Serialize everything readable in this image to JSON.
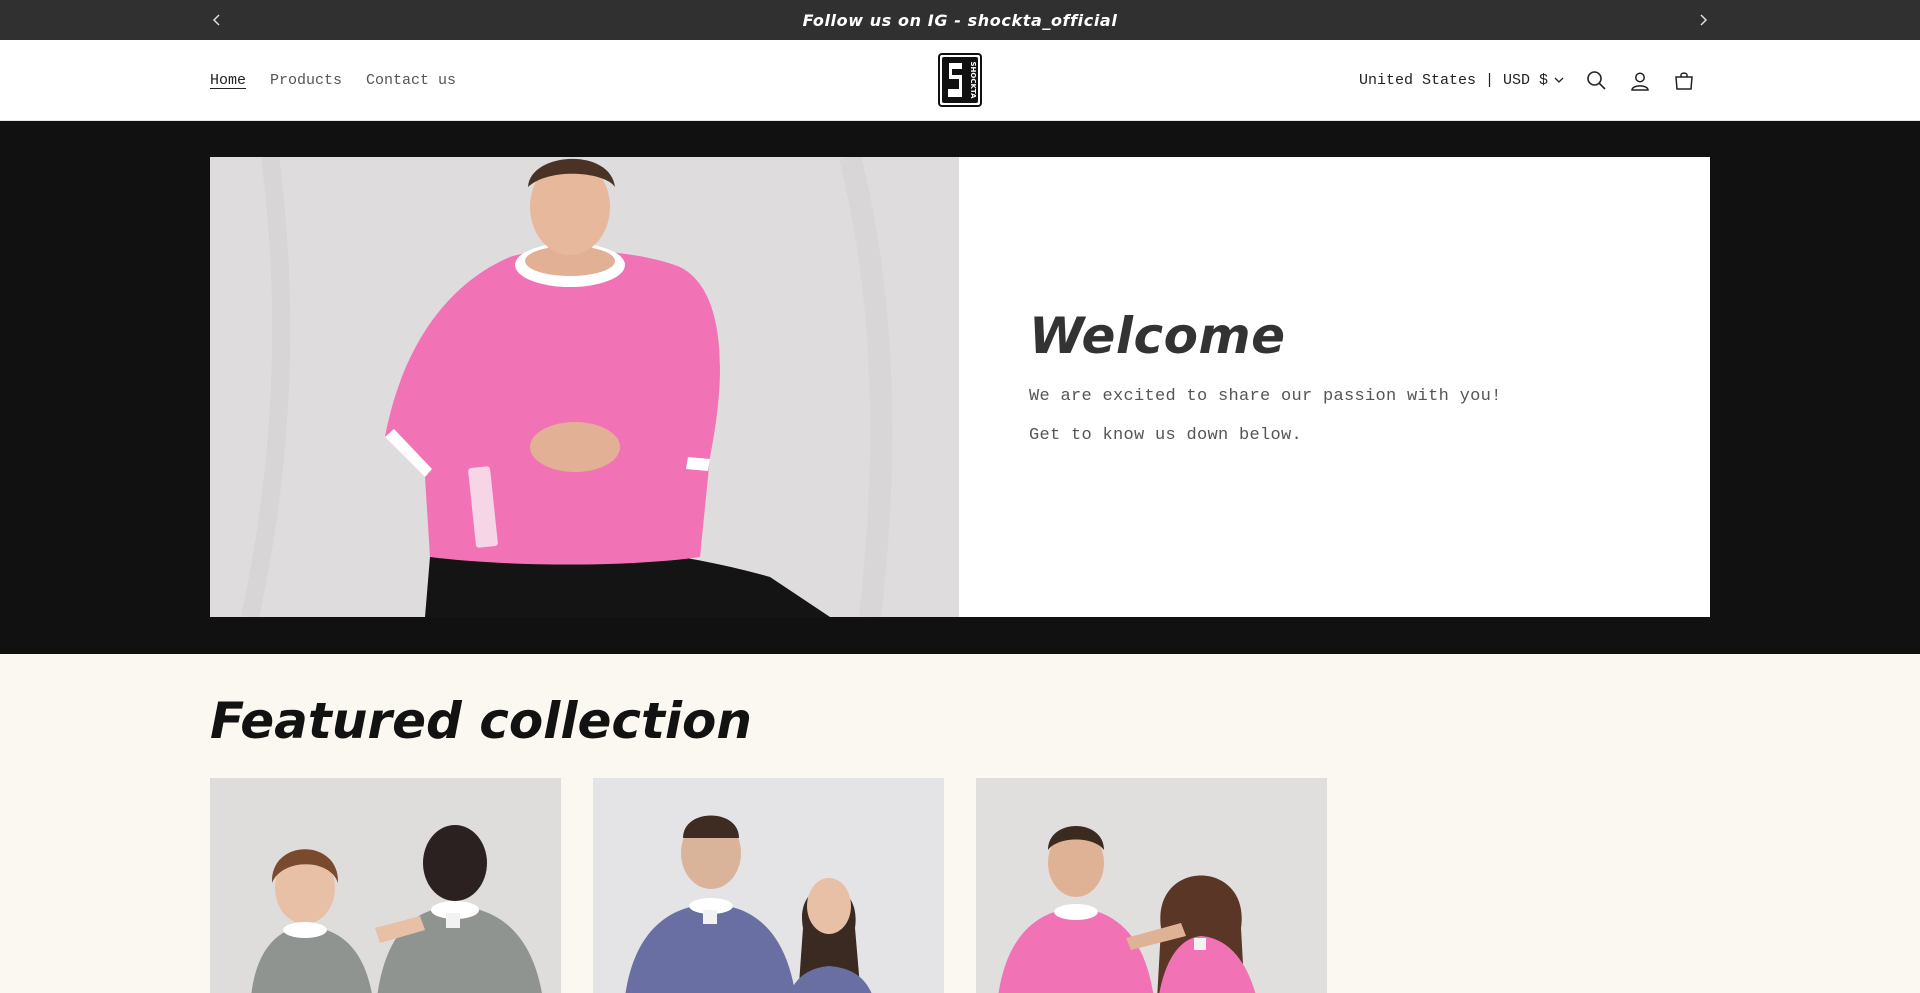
{
  "announcement": {
    "message": "Follow us on IG - shockta_official",
    "prev_icon": "chevron-left-icon",
    "next_icon": "chevron-right-icon"
  },
  "header": {
    "nav": [
      {
        "label": "Home",
        "active": true
      },
      {
        "label": "Products",
        "active": false
      },
      {
        "label": "Contact us",
        "active": false
      }
    ],
    "logo_text": "SHOCKTA",
    "locale": "United States | USD $",
    "icons": [
      "search-icon",
      "account-icon",
      "cart-icon"
    ]
  },
  "hero": {
    "title": "Welcome",
    "line1": "We are excited to share our passion with you!",
    "line2": "Get to know us down below."
  },
  "featured": {
    "title": "Featured collection"
  },
  "colors": {
    "announcement_bg": "#303030",
    "hero_bg": "#111111",
    "page_bg": "#faf8f0",
    "shirt_pink": "#f173b6",
    "shirt_grey": "#8f9490",
    "shirt_blue": "#6a6fa3"
  }
}
